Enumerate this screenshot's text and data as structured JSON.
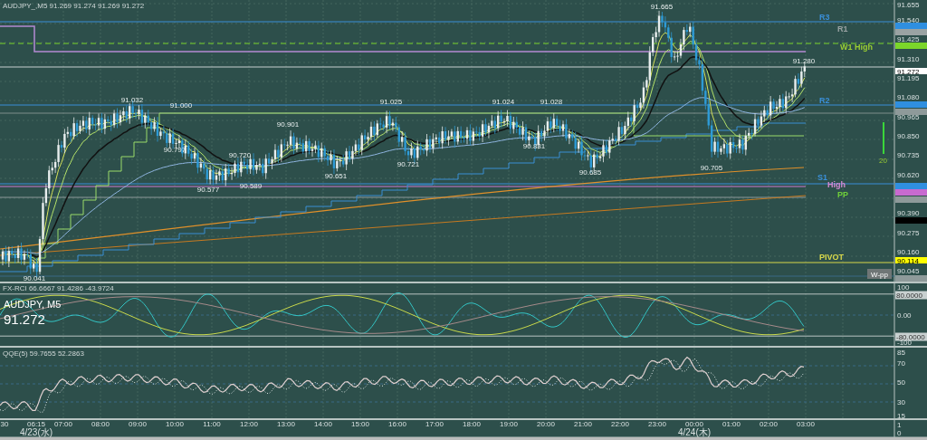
{
  "header": "AUDJPY_,M5 91.269 91.274 91.269 91.272",
  "price_axis": [
    "91.655",
    "91.540",
    "91.425",
    "91.310",
    "91.195",
    "91.080",
    "90.965",
    "90.850",
    "90.735",
    "90.620",
    "90.390",
    "90.275",
    "90.160",
    "90.045"
  ],
  "price_tags": [
    {
      "color": "#2f8fe0"
    },
    {
      "color": "#9aa3a3"
    },
    {
      "color": "#7bd62a"
    },
    {
      "text": "91.272",
      "color": "#ffffff"
    },
    {
      "color": "#2f8fe0"
    },
    {
      "color": "#8e9a9a"
    },
    {
      "color": "#2f8fe0"
    },
    {
      "color": "#c86ad0"
    },
    {
      "color": "#8e9a9a"
    },
    {
      "color": "#000000"
    },
    {
      "text": "90.114",
      "color": "#ffff00"
    },
    {
      "color": "#8e9a9a"
    }
  ],
  "level_labels": [
    {
      "text": "R3",
      "color": "#3a8fd8"
    },
    {
      "text": "R1",
      "color": "#9aa3a3"
    },
    {
      "text": "W1 High",
      "color": "#9acd32"
    },
    {
      "text": "R2",
      "color": "#3a8fd8"
    },
    {
      "text": "S1",
      "color": "#3a8fd8"
    },
    {
      "text": "High",
      "color": "#d48ad4"
    },
    {
      "text": "PP",
      "color": "#6fcf3a"
    },
    {
      "text": "PIVOT",
      "color": "#d8d84a"
    }
  ],
  "price_labels": [
    "91.665",
    "91.032",
    "91.000",
    "90.797",
    "90.720",
    "90.901",
    "91.025",
    "91.024",
    "91.028",
    "90.577",
    "90.589",
    "90.651",
    "90.721",
    "90.831",
    "90.685",
    "90.705",
    "91.280",
    "90.041"
  ],
  "volume_marker": "20",
  "w_pp_button": "W-pp",
  "symbol_overlay": {
    "symbol": "AUDJPY, M5",
    "price": "91.272"
  },
  "rci_pane": {
    "label": "FX-RCI 66.6667 91.4286 -43.9724",
    "axis": [
      {
        "text": "100",
        "kind": "tick"
      },
      {
        "text": "80.0000",
        "kind": "tag"
      },
      {
        "text": "0.00",
        "kind": "tick"
      },
      {
        "text": "-80.0000",
        "kind": "tag"
      },
      {
        "text": "-100",
        "kind": "tick"
      }
    ]
  },
  "qqe_pane": {
    "label": "QQE(5) 59.7655 52.2863",
    "axis": [
      "85",
      "70",
      "50",
      "30",
      "15"
    ]
  },
  "bottom_axis": [
    "1",
    "0"
  ],
  "time_axis": [
    {
      "time": "30"
    },
    {
      "time": "06:15",
      "date": "4/23(水)"
    },
    {
      "time": "07:00"
    },
    {
      "time": "08:00"
    },
    {
      "time": "09:00"
    },
    {
      "time": "10:00"
    },
    {
      "time": "11:00"
    },
    {
      "time": "12:00"
    },
    {
      "time": "13:00"
    },
    {
      "time": "14:00"
    },
    {
      "time": "15:00"
    },
    {
      "time": "16:00"
    },
    {
      "time": "17:00"
    },
    {
      "time": "18:00"
    },
    {
      "time": "19:00"
    },
    {
      "time": "20:00"
    },
    {
      "time": "21:00"
    },
    {
      "time": "22:00"
    },
    {
      "time": "23:00"
    },
    {
      "time": "00:00",
      "date": "4/24(木)"
    },
    {
      "time": "01:00"
    },
    {
      "time": "02:00"
    },
    {
      "time": "03:00"
    }
  ]
}
